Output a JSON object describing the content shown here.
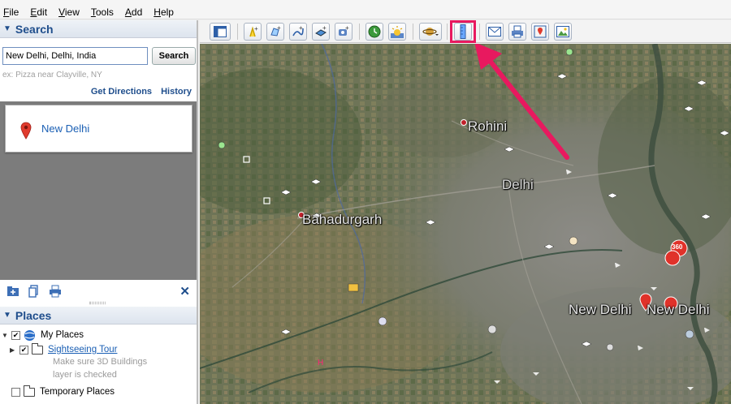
{
  "menu": [
    {
      "underline": "F",
      "rest": "ile"
    },
    {
      "underline": "E",
      "rest": "dit"
    },
    {
      "underline": "V",
      "rest": "iew"
    },
    {
      "underline": "T",
      "rest": "ools"
    },
    {
      "underline": "A",
      "rest": "dd"
    },
    {
      "underline": "H",
      "rest": "elp"
    }
  ],
  "search": {
    "header": "Search",
    "input_value": "New Delhi, Delhi, India",
    "button": "Search",
    "hint": "ex: Pizza near Clayville, NY",
    "get_directions": "Get Directions",
    "history": "History",
    "result_name": "New Delhi"
  },
  "places": {
    "header": "Places",
    "my_places": "My Places",
    "tour": "Sightseeing Tour",
    "note_line1": "Make sure 3D Buildings",
    "note_line2": "layer is checked",
    "temporary": "Temporary Places"
  },
  "map_labels": {
    "rohini": "Rohini",
    "delhi": "Delhi",
    "bahadurgarh": "Bahadurgarh",
    "new_delhi_1": "New Delhi",
    "new_delhi_2": "New Delhi",
    "badge": "360"
  },
  "colors": {
    "highlight": "#e8195f",
    "link": "#1a5fb4",
    "header": "#1f4e8c"
  }
}
